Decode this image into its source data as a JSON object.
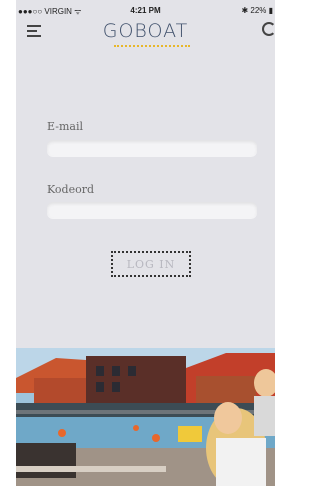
{
  "status_bar": {
    "carrier": "●●●○○ VIRGIN ᯤ",
    "time": "4:21 PM",
    "battery": "✱ 22% ▮"
  },
  "header": {
    "logo": "GOBOAT",
    "menu_icon": "hamburger-menu-icon",
    "search_icon": "search-icon"
  },
  "form": {
    "email_label": "E-mail",
    "email_value": "",
    "password_label": "Kodeord",
    "password_value": "",
    "login_label": "LOG IN"
  },
  "colors": {
    "background": "#e3e3e8",
    "logo": "#3e4f6a",
    "logo_underline": "#e8b72a",
    "button_text": "#b8b8c0"
  }
}
